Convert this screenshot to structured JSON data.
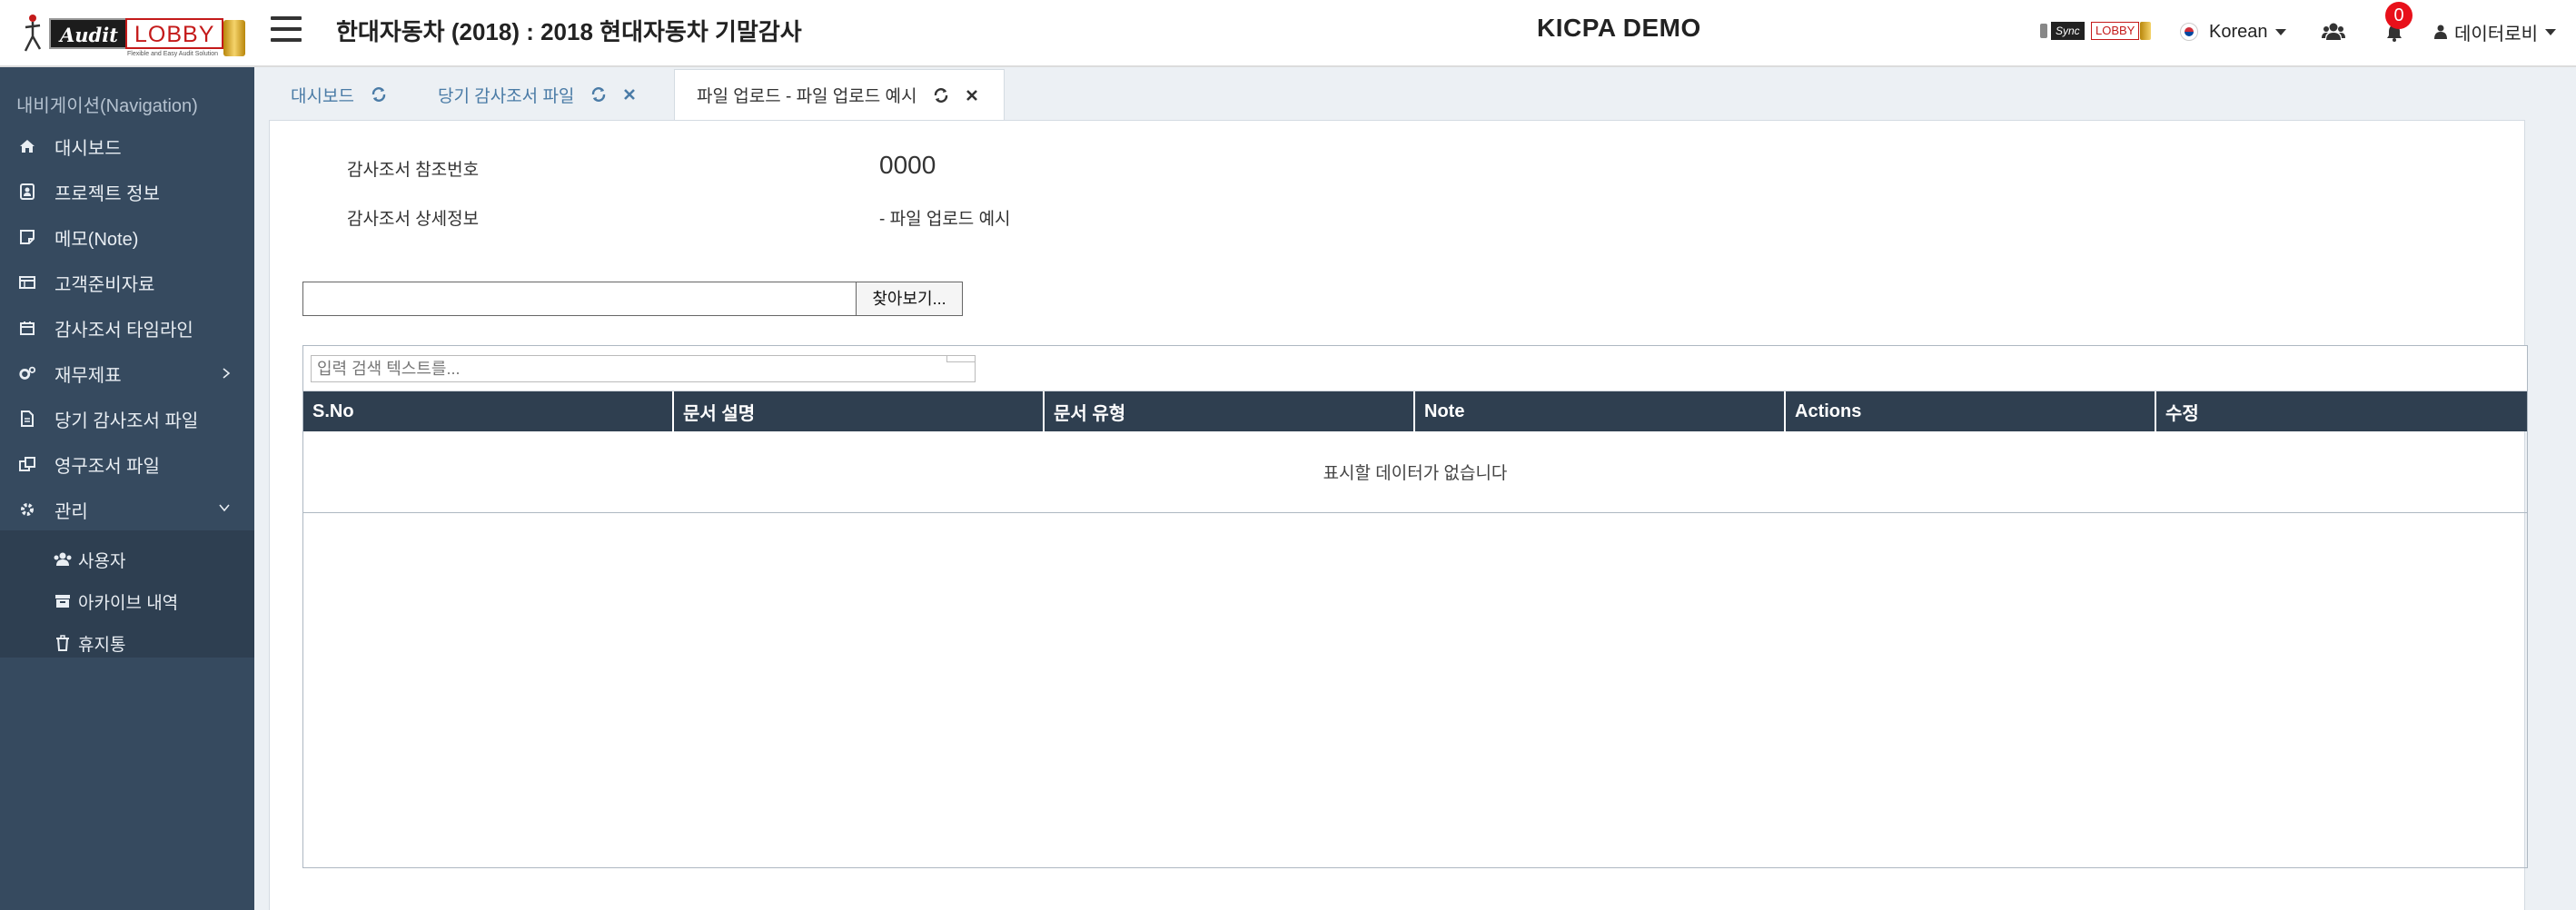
{
  "header": {
    "logo": {
      "audit": "Audit",
      "lobby": "LOBBY",
      "tagline": "Flexible and Easy Audit Solution"
    },
    "project_title": "한대자동차 (2018) : 2018 현대자동차 기말감사",
    "center_title": "KICPA DEMO",
    "sync_logo": {
      "sync": "Sync",
      "lobby": "LOBBY"
    },
    "language": "Korean",
    "notification_count": "0",
    "user_name": "데이터로비"
  },
  "sidebar": {
    "header": "내비게이션(Navigation)",
    "items": [
      {
        "label": "대시보드",
        "icon": "home-icon"
      },
      {
        "label": "프로젝트 정보",
        "icon": "id-badge-icon"
      },
      {
        "label": "메모(Note)",
        "icon": "sticky-note-icon"
      },
      {
        "label": "고객준비자료",
        "icon": "list-icon"
      },
      {
        "label": "감사조서 타임라인",
        "icon": "calendar-icon"
      },
      {
        "label": "재무제표",
        "icon": "cogs-icon"
      },
      {
        "label": "당기 감사조서 파일",
        "icon": "file-icon"
      },
      {
        "label": "영구조서 파일",
        "icon": "clone-icon"
      },
      {
        "label": "관리",
        "icon": "gear-icon"
      }
    ],
    "submenu": [
      {
        "label": "사용자",
        "icon": "users-icon"
      },
      {
        "label": "아카이브 내역",
        "icon": "archive-icon"
      },
      {
        "label": "휴지통",
        "icon": "trash-icon"
      }
    ]
  },
  "tabs": [
    {
      "label": "대시보드"
    },
    {
      "label": "당기 감사조서 파일"
    },
    {
      "label": "파일 업로드 - 파일 업로드 예시",
      "active": true
    }
  ],
  "form": {
    "ref_label": "감사조서 참조번호",
    "ref_value": "0000",
    "detail_label": "감사조서 상세정보",
    "detail_value": "- 파일 업로드 예시",
    "file_value": "",
    "browse_label": "찾아보기..."
  },
  "grid": {
    "search_placeholder": "입력 검색 텍스트를...",
    "columns": [
      "S.No",
      "문서 설명",
      "문서 유형",
      "Note",
      "Actions",
      "수정"
    ],
    "empty_message": "표시할 데이터가 없습니다"
  },
  "colors": {
    "sidebar_bg": "#364a5f",
    "submenu_bg": "#2e3f51",
    "table_header_bg": "#2f3f50",
    "badge_red": "#e8101a",
    "tab_link": "#4a7ba6"
  }
}
